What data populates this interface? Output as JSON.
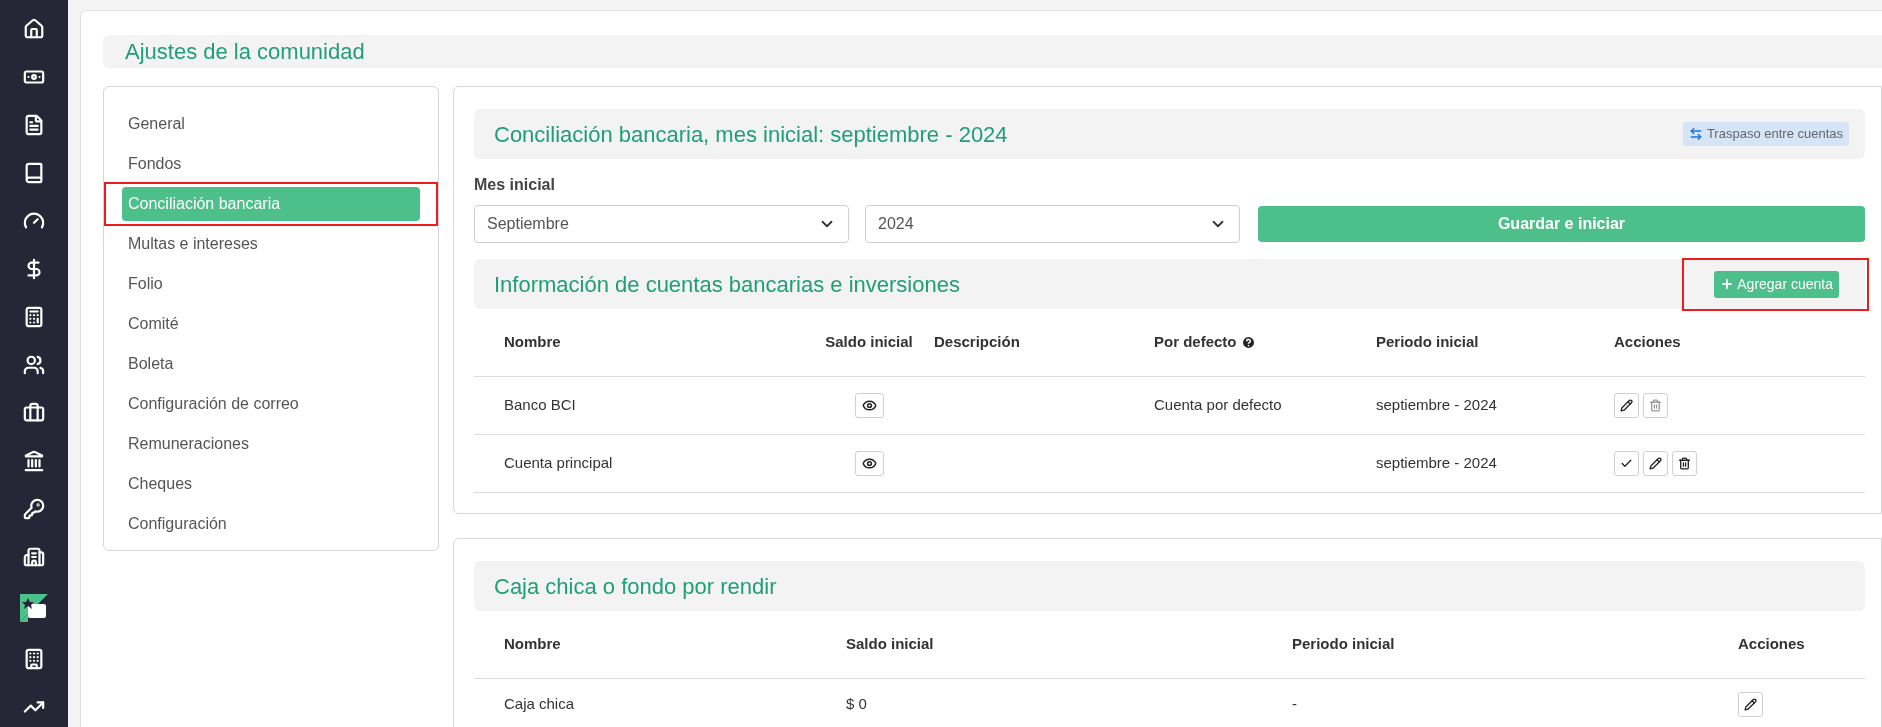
{
  "nav": [
    {
      "kind": "home"
    },
    {
      "kind": "money"
    },
    {
      "kind": "document"
    },
    {
      "kind": "book"
    },
    {
      "kind": "gauge"
    },
    {
      "kind": "dollar"
    },
    {
      "kind": "calculator"
    },
    {
      "kind": "users"
    },
    {
      "kind": "briefcase"
    },
    {
      "kind": "bank"
    },
    {
      "kind": "key"
    },
    {
      "kind": "building-shield"
    },
    {
      "kind": "logo"
    },
    {
      "kind": "building"
    },
    {
      "kind": "chart"
    }
  ],
  "page_title": "Ajustes de la comunidad",
  "settings_menu": [
    {
      "label": "General",
      "selected": false,
      "annotated": false
    },
    {
      "label": "Fondos",
      "selected": false,
      "annotated": false
    },
    {
      "label": "Conciliación bancaria",
      "selected": true,
      "annotated": true
    },
    {
      "label": "Multas e intereses",
      "selected": false,
      "annotated": false
    },
    {
      "label": "Folio",
      "selected": false,
      "annotated": false
    },
    {
      "label": "Comité",
      "selected": false,
      "annotated": false
    },
    {
      "label": "Boleta",
      "selected": false,
      "annotated": false
    },
    {
      "label": "Configuración de correo",
      "selected": false,
      "annotated": false
    },
    {
      "label": "Remuneraciones",
      "selected": false,
      "annotated": false
    },
    {
      "label": "Cheques",
      "selected": false,
      "annotated": false
    },
    {
      "label": "Configuración",
      "selected": false,
      "annotated": false
    }
  ],
  "bank_section": {
    "title": "Conciliación bancaria, mes inicial: septiembre - 2024",
    "transfer_button": "Traspaso entre cuentas",
    "field_label": "Mes inicial",
    "month": "Septiembre",
    "year": "2024",
    "save_button": "Guardar e iniciar",
    "accounts_title": "Información de cuentas bancarias e inversiones",
    "add_button": {
      "label": "Agregar cuenta",
      "annotated": true
    },
    "columns": [
      "Nombre",
      "Saldo inicial",
      "Descripción",
      "Por defecto",
      "Periodo inicial",
      "Acciones"
    ],
    "rows": [
      {
        "name": "Banco BCI",
        "description": "",
        "default": "Cuenta por defecto",
        "period": "septiembre - 2024",
        "actions": [
          {
            "kind": "edit",
            "disabled": false
          },
          {
            "kind": "delete",
            "disabled": true
          }
        ]
      },
      {
        "name": "Cuenta principal",
        "description": "",
        "default": "",
        "period": "septiembre - 2024",
        "actions": [
          {
            "kind": "check",
            "disabled": false
          },
          {
            "kind": "edit",
            "disabled": false
          },
          {
            "kind": "delete",
            "disabled": false
          }
        ]
      }
    ]
  },
  "petty_cash": {
    "title": "Caja chica o fondo por rendir",
    "columns": [
      "Nombre",
      "Saldo inicial",
      "Periodo inicial",
      "Acciones"
    ],
    "rows": [
      {
        "name": "Caja chica",
        "balance": "$ 0",
        "period": "-",
        "actions": [
          {
            "kind": "edit",
            "disabled": false
          }
        ]
      }
    ]
  }
}
